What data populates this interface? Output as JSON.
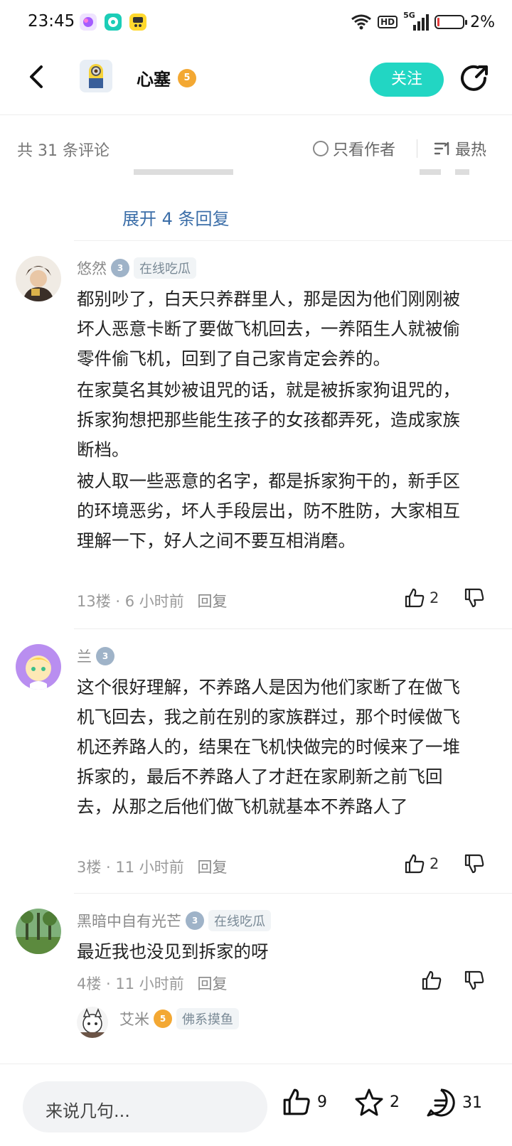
{
  "status_bar": {
    "time": "23:45",
    "network": "5G",
    "hd": "HD",
    "battery_percent": "2%",
    "icons": [
      "app-badge-purple",
      "app-badge-teal",
      "app-badge-yellow",
      "wifi-icon",
      "hd-icon",
      "signal-icon",
      "battery-icon"
    ]
  },
  "header": {
    "author_name": "心塞",
    "author_level": "5",
    "follow_label": "关注",
    "icons": [
      "back-icon",
      "share-icon"
    ]
  },
  "filter_bar": {
    "comment_count": "共 31 条评论",
    "author_only_label": "只看作者",
    "sort_label": "最热"
  },
  "expand_replies": "展开 4 条回复",
  "comments": [
    {
      "user": "悠然",
      "level": "3",
      "tag": "在线吃瓜",
      "paragraphs": [
        "都别吵了，白天只养群里人，那是因为他们刚刚被坏人恶意卡断了要做飞机回去，一养陌生人就被偷零件偷飞机，回到了自己家肯定会养的。",
        "在家莫名其妙被诅咒的话，就是被拆家狗诅咒的，拆家狗想把那些能生孩子的女孩都弄死，造成家族断档。",
        "被人取一些恶意的名字，都是拆家狗干的，新手区的环境恶劣，坏人手段层出，防不胜防，大家相互理解一下，好人之间不要互相消磨。"
      ],
      "floor_time": "13楼 · 6 小时前",
      "reply_label": "回复",
      "likes": "2"
    },
    {
      "user": "兰",
      "level": "3",
      "tag": "",
      "paragraphs": [
        "这个很好理解，不养路人是因为他们家断了在做飞机飞回去，我之前在别的家族群过，那个时候做飞机还养路人的，结果在飞机快做完的时候来了一堆拆家的，最后不养路人了才赶在家刷新之前飞回去，从那之后他们做飞机就基本不养路人了"
      ],
      "floor_time": "3楼 · 11 小时前",
      "reply_label": "回复",
      "likes": "2"
    },
    {
      "user": "黑暗中自有光芒",
      "level": "3",
      "tag": "在线吃瓜",
      "paragraphs": [
        "最近我也没见到拆家的呀"
      ],
      "floor_time": "4楼 · 11 小时前",
      "reply_label": "回复",
      "likes": ""
    }
  ],
  "partial_comment": {
    "user": "艾米",
    "level": "5",
    "tag": "佛系摸鱼"
  },
  "bottom_bar": {
    "input_placeholder": "来说几句...",
    "likes": "9",
    "favorites": "2",
    "comments": "31"
  },
  "colors": {
    "accent": "#22d6c3",
    "link": "#3b6ea8",
    "level_gold": "#f3a833",
    "level_gray": "#9fb3c8"
  }
}
